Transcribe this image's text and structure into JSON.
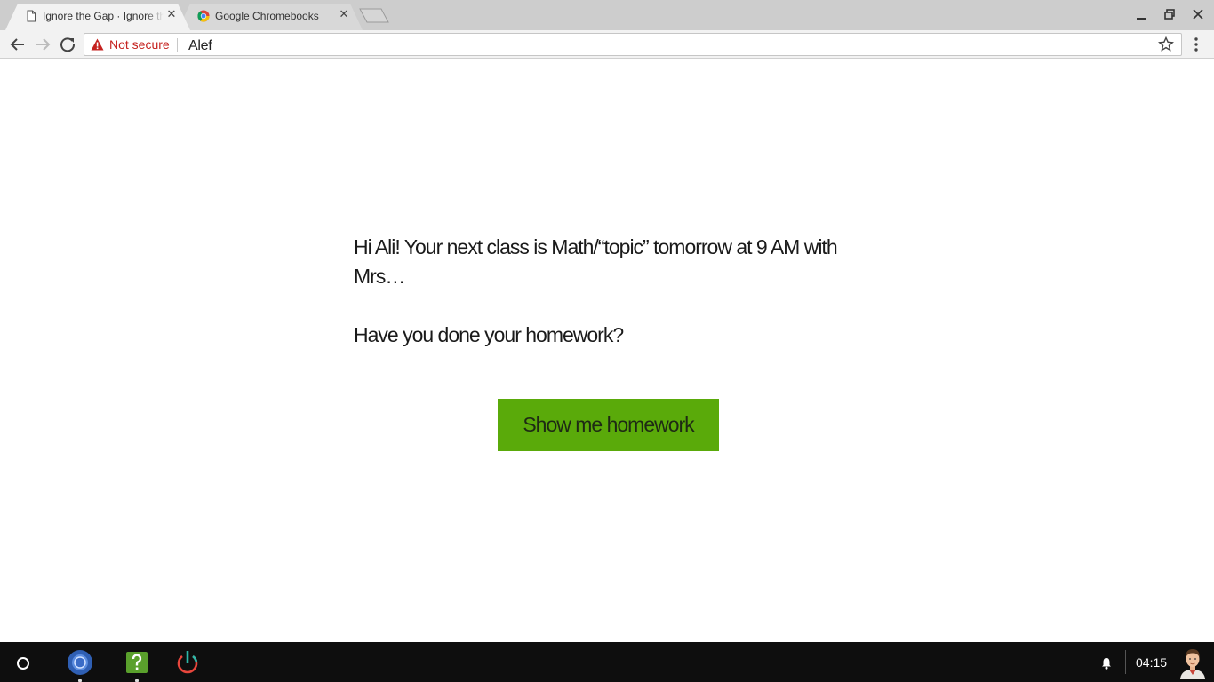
{
  "tabs": [
    {
      "title": "Ignore the Gap · Ignore the Gap",
      "favicon": "page-icon",
      "active": true
    },
    {
      "title": "Google Chromebooks",
      "favicon": "chrome-icon",
      "active": false
    }
  ],
  "toolbar": {
    "security_label": "Not secure",
    "url": "Alef"
  },
  "page": {
    "greeting": "Hi Ali! Your next class is Math/“topic” tomorrow at 9 AM with Mrs…",
    "question": "Have you done your homework?",
    "button_label": "Show me homework"
  },
  "shelf": {
    "apps": [
      {
        "name": "chrome-icon",
        "running": true
      },
      {
        "name": "help-icon",
        "running": true
      },
      {
        "name": "app-power-icon",
        "running": false
      }
    ],
    "time": "04:15"
  },
  "colors": {
    "button_bg": "#5aaa0a",
    "not_secure": "#c5221f",
    "shelf_bg": "#0e0e0e",
    "tabstrip_bg": "#cdcdcd"
  }
}
